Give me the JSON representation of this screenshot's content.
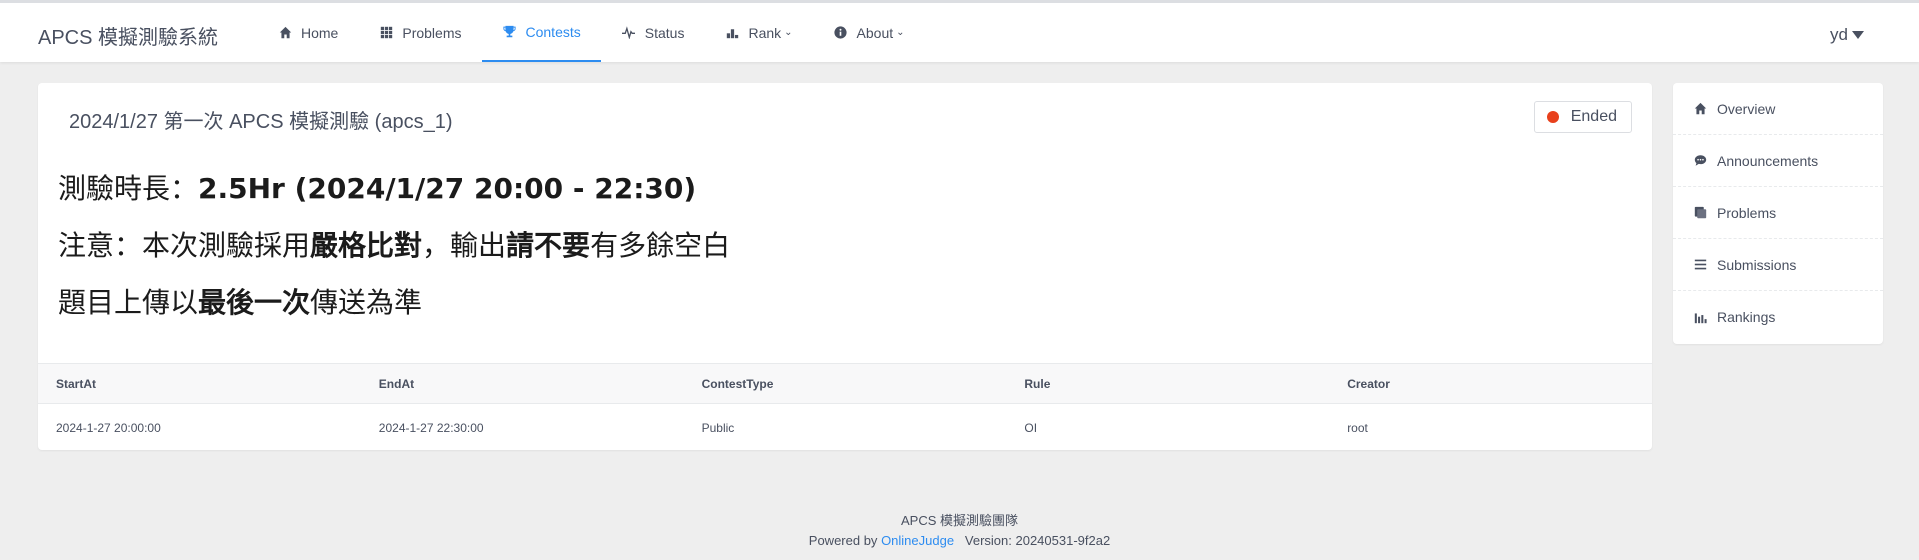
{
  "header": {
    "brand": "APCS 模擬測驗系統",
    "nav": [
      {
        "label": "Home",
        "icon": "home-icon"
      },
      {
        "label": "Problems",
        "icon": "grid-icon"
      },
      {
        "label": "Contests",
        "icon": "trophy-icon",
        "active": true
      },
      {
        "label": "Status",
        "icon": "pulse-icon"
      },
      {
        "label": "Rank",
        "icon": "bar-chart-icon",
        "dropdown": true
      },
      {
        "label": "About",
        "icon": "info-icon",
        "dropdown": true
      }
    ],
    "user": "yd"
  },
  "contest": {
    "title": "2024/1/27 第一次 APCS 模擬測驗 (apcs_1)",
    "status": "Ended",
    "status_color": "#e8401c",
    "desc": {
      "line1_prefix": "測驗時長：",
      "line1_bold": "2.5Hr (2024/1/27 20:00 - 22:30)",
      "line2_prefix": "注意：本次測驗採用",
      "line2_bold1": "嚴格比對",
      "line2_mid": "，輸出",
      "line2_bold2": "請不要",
      "line2_suffix": "有多餘空白",
      "line3_prefix": "題目上傳以",
      "line3_bold": "最後一次",
      "line3_suffix": "傳送為準"
    },
    "table": {
      "headers": [
        "StartAt",
        "EndAt",
        "ContestType",
        "Rule",
        "Creator"
      ],
      "row": [
        "2024-1-27 20:00:00",
        "2024-1-27 22:30:00",
        "Public",
        "OI",
        "root"
      ]
    }
  },
  "sidebar": {
    "items": [
      {
        "label": "Overview",
        "icon": "home-icon"
      },
      {
        "label": "Announcements",
        "icon": "chat-icon"
      },
      {
        "label": "Problems",
        "icon": "book-icon"
      },
      {
        "label": "Submissions",
        "icon": "list-icon"
      },
      {
        "label": "Rankings",
        "icon": "bar-chart-icon"
      }
    ]
  },
  "footer": {
    "team": "APCS 模擬測驗團隊",
    "powered_prefix": "Powered by",
    "powered_link": "OnlineJudge",
    "version": "Version: 20240531-9f2a2"
  },
  "colors": {
    "accent": "#2d8cf0",
    "background": "#eeeeee"
  }
}
